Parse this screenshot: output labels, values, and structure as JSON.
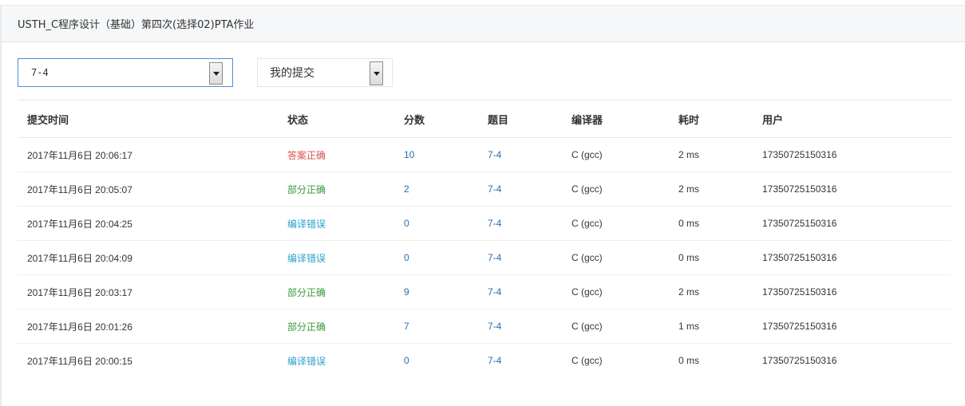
{
  "header": {
    "title": "USTH_C程序设计（基础）第四次(选择02)PTA作业"
  },
  "filters": {
    "problem_select": "7-4",
    "scope_select": "我的提交"
  },
  "table": {
    "columns": [
      "提交时间",
      "状态",
      "分数",
      "题目",
      "编译器",
      "耗时",
      "用户"
    ],
    "rows": [
      {
        "time": "2017年11月6日 20:06:17",
        "status": "答案正确",
        "status_color": "#d9534f",
        "score": "10",
        "problem": "7-4",
        "compiler": "C (gcc)",
        "cost": "2 ms",
        "user": "17350725150316"
      },
      {
        "time": "2017年11月6日 20:05:07",
        "status": "部分正确",
        "status_color": "#3a9a3a",
        "score": "2",
        "problem": "7-4",
        "compiler": "C (gcc)",
        "cost": "2 ms",
        "user": "17350725150316"
      },
      {
        "time": "2017年11月6日 20:04:25",
        "status": "编译错误",
        "status_color": "#2aa0cf",
        "score": "0",
        "problem": "7-4",
        "compiler": "C (gcc)",
        "cost": "0 ms",
        "user": "17350725150316"
      },
      {
        "time": "2017年11月6日 20:04:09",
        "status": "编译错误",
        "status_color": "#2aa0cf",
        "score": "0",
        "problem": "7-4",
        "compiler": "C (gcc)",
        "cost": "0 ms",
        "user": "17350725150316"
      },
      {
        "time": "2017年11月6日 20:03:17",
        "status": "部分正确",
        "status_color": "#3a9a3a",
        "score": "9",
        "problem": "7-4",
        "compiler": "C (gcc)",
        "cost": "2 ms",
        "user": "17350725150316"
      },
      {
        "time": "2017年11月6日 20:01:26",
        "status": "部分正确",
        "status_color": "#3a9a3a",
        "score": "7",
        "problem": "7-4",
        "compiler": "C (gcc)",
        "cost": "1 ms",
        "user": "17350725150316"
      },
      {
        "time": "2017年11月6日 20:00:15",
        "status": "编译错误",
        "status_color": "#2aa0cf",
        "score": "0",
        "problem": "7-4",
        "compiler": "C (gcc)",
        "cost": "0 ms",
        "user": "17350725150316"
      }
    ]
  }
}
